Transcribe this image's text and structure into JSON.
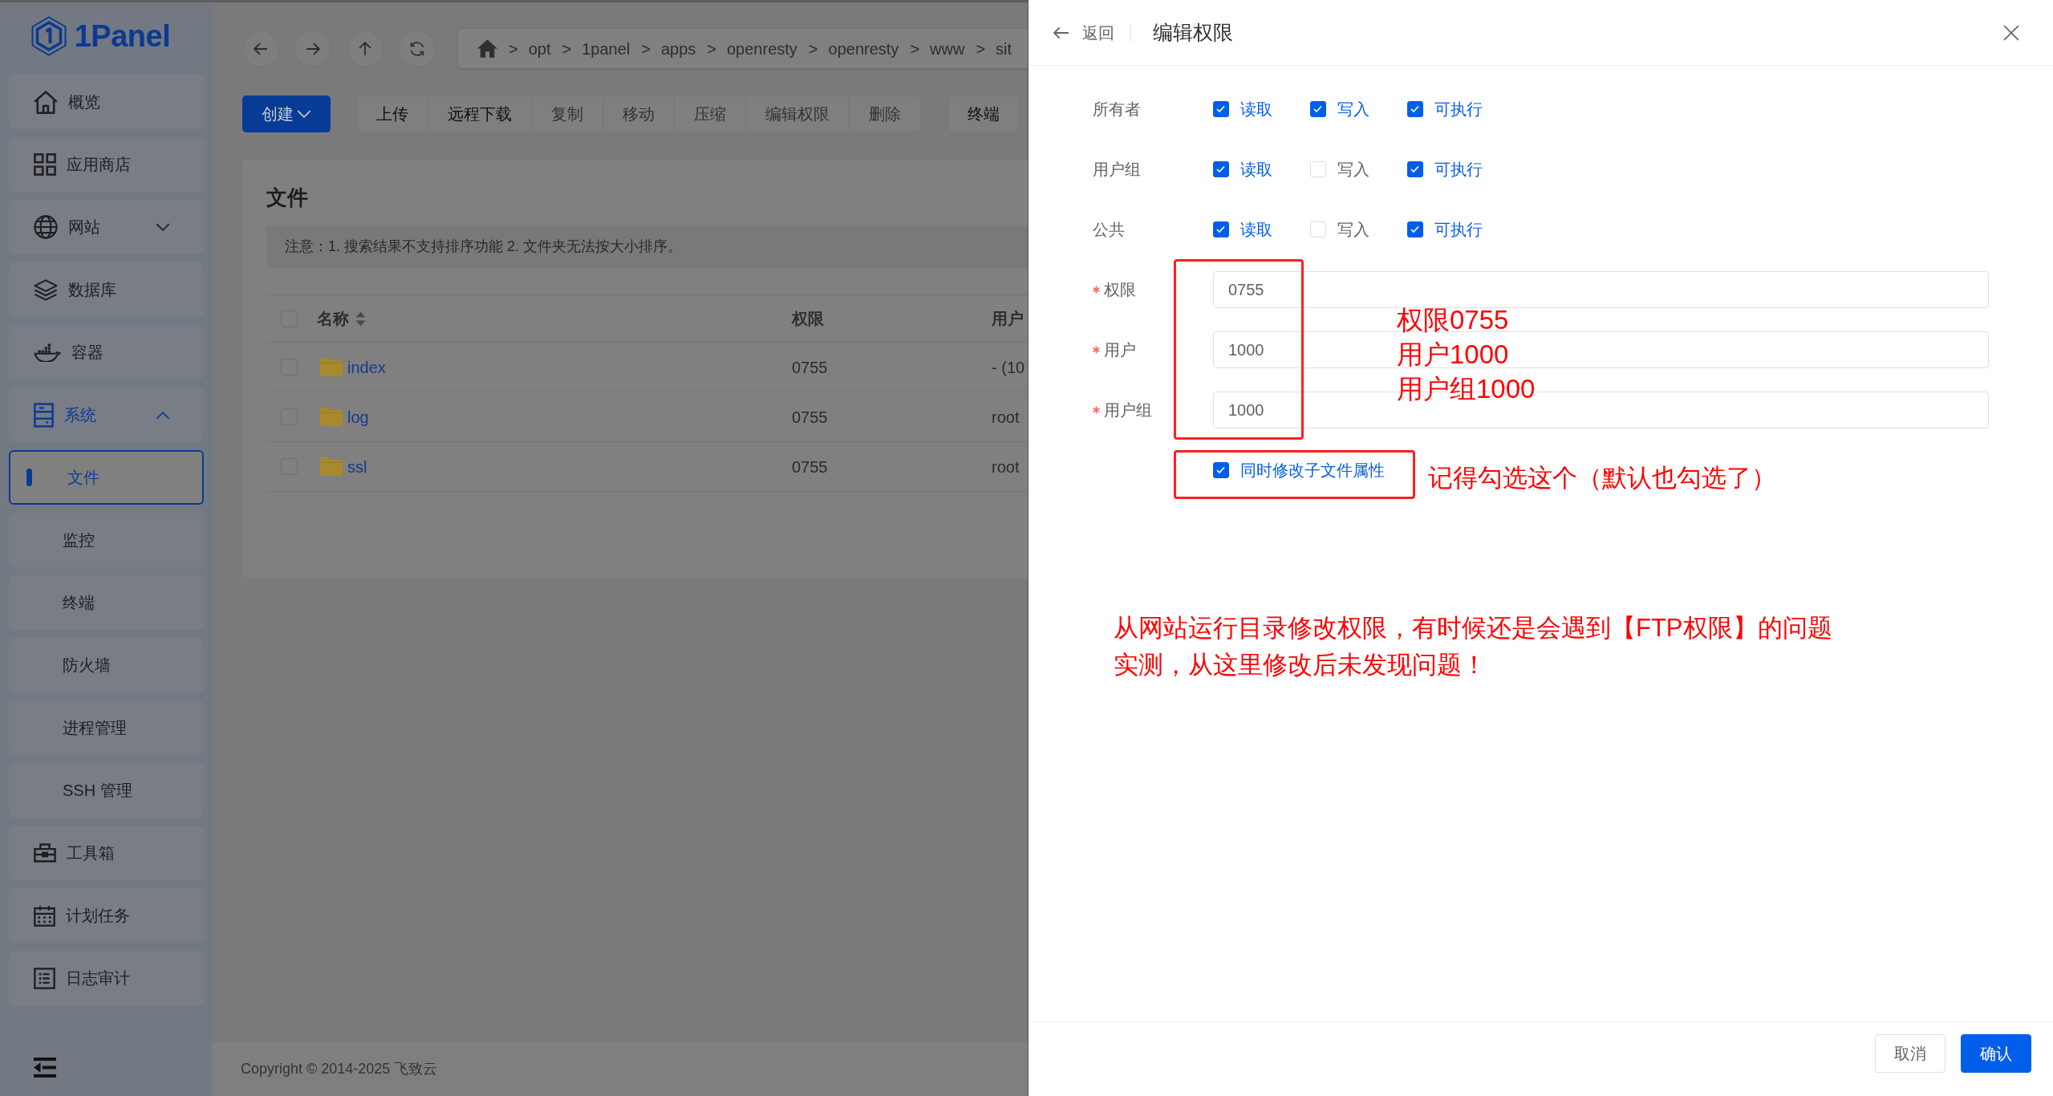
{
  "sidebar": {
    "logo": "1Panel",
    "items": [
      {
        "label": "概览",
        "selected": false
      },
      {
        "label": "应用商店",
        "selected": false
      },
      {
        "label": "网站",
        "selected": false,
        "expanded": false
      },
      {
        "label": "数据库",
        "selected": false
      },
      {
        "label": "容器",
        "selected": false
      },
      {
        "label": "系统",
        "selected": false,
        "expanded": true,
        "children": [
          {
            "label": "文件",
            "selected": true
          },
          {
            "label": "监控",
            "selected": false
          },
          {
            "label": "终端",
            "selected": false
          },
          {
            "label": "防火墙",
            "selected": false
          },
          {
            "label": "进程管理",
            "selected": false
          },
          {
            "label": "SSH 管理",
            "selected": false
          }
        ]
      },
      {
        "label": "工具箱",
        "selected": false
      },
      {
        "label": "计划任务",
        "selected": false
      },
      {
        "label": "日志审计",
        "selected": false
      }
    ]
  },
  "breadcrumb": {
    "separator": ">",
    "path": [
      "opt",
      "1panel",
      "apps",
      "openresty",
      "openresty",
      "www",
      "sit"
    ]
  },
  "toolbar": {
    "create_button": "创建",
    "actions": [
      {
        "label": "上传",
        "disabled": false
      },
      {
        "label": "远程下载",
        "disabled": false
      },
      {
        "label": "复制",
        "disabled": true
      },
      {
        "label": "移动",
        "disabled": true
      },
      {
        "label": "压缩",
        "disabled": true
      },
      {
        "label": "编辑权限",
        "disabled": true
      },
      {
        "label": "删除",
        "disabled": true
      }
    ],
    "terminal_button": "终端"
  },
  "file_panel": {
    "title": "文件",
    "notice": "注意：1. 搜索结果不支持排序功能 2. 文件夹无法按大小排序。",
    "select_all_checked": false,
    "columns": [
      "名称",
      "权限",
      "用户"
    ],
    "rows": [
      {
        "name": "index",
        "permission": "0755",
        "user": "- (10",
        "checked": false
      },
      {
        "name": "log",
        "permission": "0755",
        "user": "root",
        "checked": false
      },
      {
        "name": "ssl",
        "permission": "0755",
        "user": "root",
        "checked": false
      }
    ]
  },
  "footer": {
    "copyright": "Copyright © 2014-2025 飞致云"
  },
  "drawer": {
    "back": "返回",
    "title": "编辑权限",
    "permission_groups": [
      {
        "label": "所有者",
        "options": [
          {
            "label": "读取",
            "checked": true
          },
          {
            "label": "写入",
            "checked": true
          },
          {
            "label": "可执行",
            "checked": true
          }
        ]
      },
      {
        "label": "用户组",
        "options": [
          {
            "label": "读取",
            "checked": true
          },
          {
            "label": "写入",
            "checked": false
          },
          {
            "label": "可执行",
            "checked": true
          }
        ]
      },
      {
        "label": "公共",
        "options": [
          {
            "label": "读取",
            "checked": true
          },
          {
            "label": "写入",
            "checked": false
          },
          {
            "label": "可执行",
            "checked": true
          }
        ]
      }
    ],
    "fields": [
      {
        "label": "权限",
        "required": true,
        "value": "0755"
      },
      {
        "label": "用户",
        "required": true,
        "value": "1000"
      },
      {
        "label": "用户组",
        "required": true,
        "value": "1000"
      }
    ],
    "recursive": {
      "label": "同时修改子文件属性",
      "checked": true
    },
    "buttons": [
      {
        "label": "取消",
        "kind": "secondary"
      },
      {
        "label": "确认",
        "kind": "primary"
      }
    ]
  },
  "annotations": {
    "field_note": [
      "权限0755",
      "用户1000",
      "用户组1000"
    ],
    "checkbox_note": "记得勾选这个（默认也勾选了）",
    "bottom_note": [
      "从网站运行目录修改权限，有时候还是会遇到【FTP权限】的问题",
      "实测，从这里修改后未发现问题！"
    ]
  }
}
